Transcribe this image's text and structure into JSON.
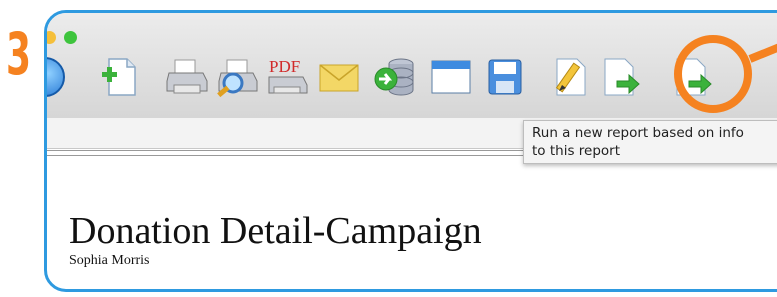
{
  "step_label": "3",
  "accent_color": "#f58220",
  "frame_color": "#2e9ae0",
  "toolbar": {
    "icons": [
      "new-document-icon",
      "print-icon",
      "print-preview-icon",
      "print-pdf-icon",
      "email-icon",
      "export-database-icon",
      "window-icon",
      "save-icon",
      "edit-icon",
      "run-report-icon",
      "run-new-report-icon"
    ],
    "pdf_text": "PDF"
  },
  "tooltip": {
    "line1": "Run a new report based on info",
    "line2": "to this report"
  },
  "report": {
    "title": "Donation Detail-Campaign",
    "author": "Sophia Morris"
  }
}
